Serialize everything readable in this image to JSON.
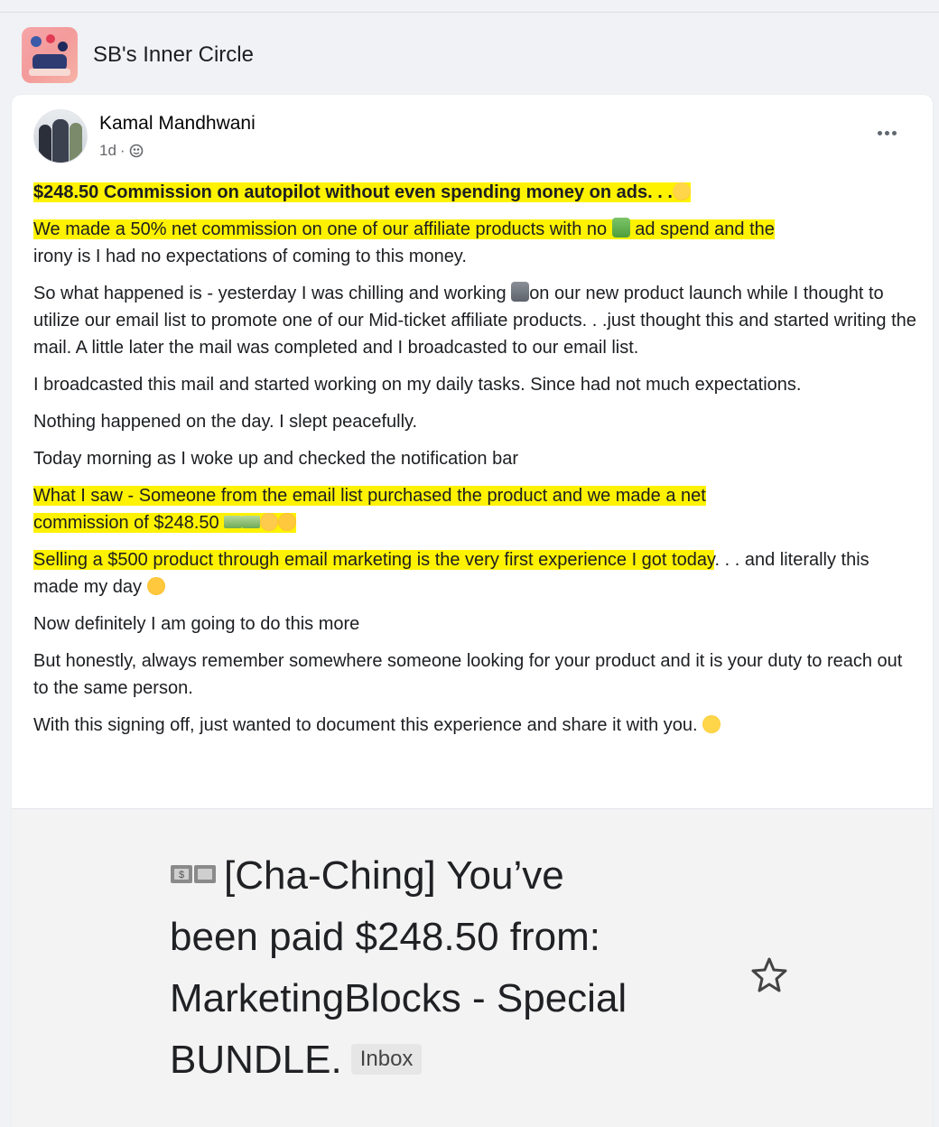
{
  "group": {
    "name": "SB's Inner Circle"
  },
  "post": {
    "author": "Kamal Mandhwani",
    "time": "1d",
    "meta_separator": "·",
    "privacy_icon": "globe-icon",
    "more_icon": "more-horizontal-icon",
    "paragraphs": {
      "p1": "$248.50 Commission on autopilot without even spending money on ads. . .",
      "p2_a": "We made a 50% net commission on one of our affiliate products with no ",
      "p2_b": " ad spend and the",
      "p2_c": "irony is I had no expectations of coming to this money.",
      "p3_a": "So what happened is - yesterday I was chilling and working ",
      "p3_b": "on our new product launch while I thought to utilize our email list to promote one of our Mid-ticket affiliate products. . .just thought this and started writing the mail. A little later the mail was completed and I broadcasted to our email list.",
      "p4": "I broadcasted this mail and started working on my daily tasks. Since had not much expectations.",
      "p5": "Nothing happened on the day. I slept peacefully.",
      "p6": "Today morning as I woke up and checked the notification bar",
      "p7_a": "What I saw - Someone from the email list purchased the product and we made a net",
      "p7_b": "commission of $248.50 ",
      "p8_a": "Selling a $500 product through email marketing is the very first experience I got today",
      "p8_b": ". . . and literally this made my day ",
      "p9": "Now definitely I am going to do this more",
      "p10": "But honestly, always remember somewhere someone looking for your product and it is your duty to reach out to the same person.",
      "p11": "With this signing off, just wanted to document this experience and share it with you. "
    },
    "highlight_color": "#fff200"
  },
  "attachment": {
    "subject_line1": "[Cha-Ching] You’ve",
    "subject_line2": "been paid $248.50 from:",
    "subject_line3": "MarketingBlocks - Special",
    "subject_line4": "BUNDLE.",
    "label": "Inbox",
    "star_icon": "star-outline-icon",
    "bills_icon": "dollar-bills-icon"
  }
}
